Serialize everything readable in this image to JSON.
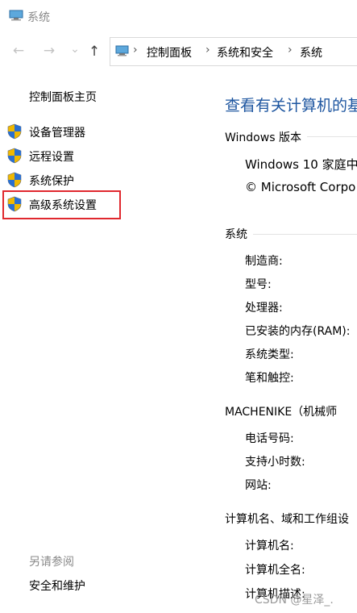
{
  "window": {
    "title": "系统"
  },
  "nav": {
    "back": "←",
    "forward": "→",
    "dropdown": "⌄",
    "up": "↑",
    "breadcrumbs": [
      "控制面板",
      "系统和安全",
      "系统"
    ],
    "separator": "›"
  },
  "left_pane": {
    "home_link": "控制面板主页",
    "links": [
      "设备管理器",
      "远程设置",
      "系统保护",
      "高级系统设置"
    ],
    "see_also_title": "另请参阅",
    "see_also_links": [
      "安全和维护"
    ]
  },
  "main": {
    "heading": "查看有关计算机的基",
    "windows_section": {
      "title": "Windows 版本",
      "edition": "Windows 10 家庭中",
      "copyright": "© Microsoft Corpo"
    },
    "system_section": {
      "title": "系统",
      "fields": [
        "制造商:",
        "型号:",
        "处理器:",
        "已安装的内存(RAM):",
        "系统类型:",
        "笔和触控:"
      ]
    },
    "oem_section": {
      "title": "MACHENIKE（机械师",
      "fields": [
        "电话号码:",
        "支持小时数:",
        "网站:"
      ]
    },
    "computer_section": {
      "title": "计算机名、域和工作组设",
      "fields": [
        "计算机名:",
        "计算机全名:",
        "计算机描述:"
      ]
    }
  },
  "watermark": "CSDN @星泽_.",
  "colors": {
    "heading_blue": "#1e56a0",
    "highlight_red": "#e0282e"
  }
}
